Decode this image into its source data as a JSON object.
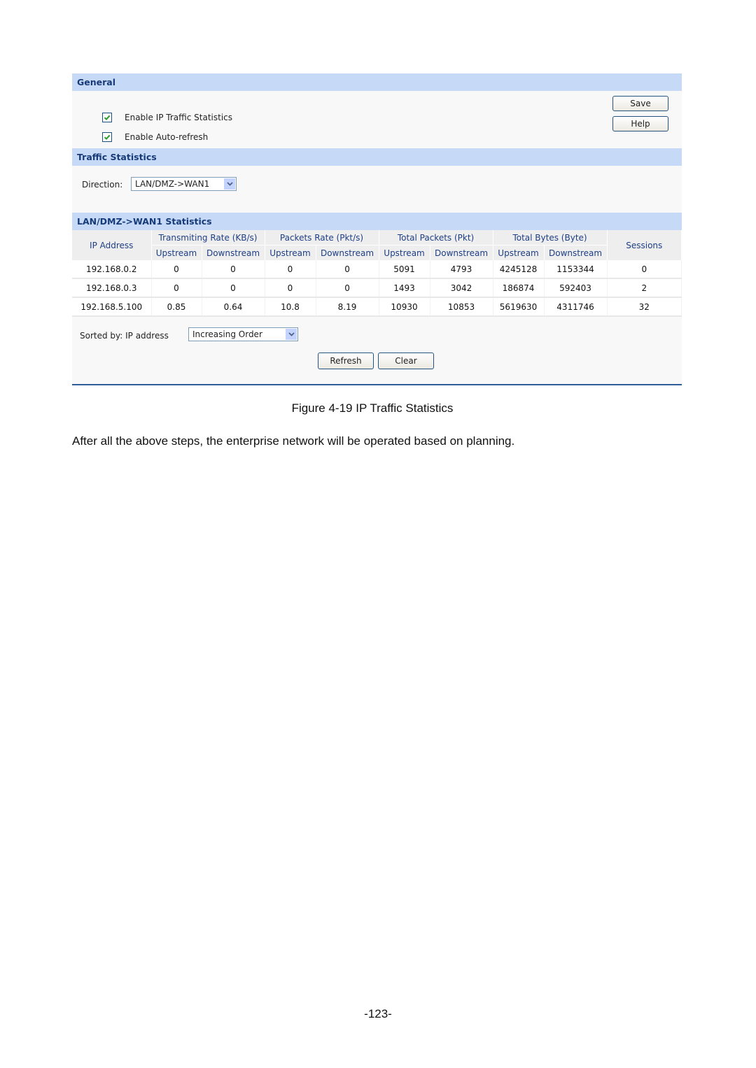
{
  "general": {
    "title": "General",
    "checkboxes": [
      {
        "label": "Enable IP Traffic Statistics",
        "checked": true
      },
      {
        "label": "Enable Auto-refresh",
        "checked": true
      }
    ],
    "save_label": "Save",
    "help_label": "Help"
  },
  "traffic": {
    "title": "Traffic Statistics",
    "direction_label": "Direction:",
    "direction_value": "LAN/DMZ->WAN1"
  },
  "stats": {
    "title": "LAN/DMZ->WAN1 Statistics",
    "headers": {
      "ip": "IP Address",
      "groups": [
        "Transmiting Rate (KB/s)",
        "Packets Rate (Pkt/s)",
        "Total Packets (Pkt)",
        "Total Bytes (Byte)"
      ],
      "upstream": "Upstream",
      "downstream": "Downstream",
      "sessions": "Sessions"
    },
    "rows": [
      [
        "192.168.0.2",
        "0",
        "0",
        "0",
        "0",
        "5091",
        "4793",
        "4245128",
        "1153344",
        "0"
      ],
      [
        "192.168.0.3",
        "0",
        "0",
        "0",
        "0",
        "1493",
        "3042",
        "186874",
        "592403",
        "2"
      ],
      [
        "192.168.5.100",
        "0.85",
        "0.64",
        "10.8",
        "8.19",
        "10930",
        "10853",
        "5619630",
        "4311746",
        "32"
      ]
    ],
    "sort_label": "Sorted by: IP address",
    "sort_value": "Increasing Order",
    "refresh_label": "Refresh",
    "clear_label": "Clear"
  },
  "document": {
    "caption": "Figure 4-19 IP Traffic Statistics",
    "paragraph": "After all the above steps, the enterprise network will be operated based on planning.",
    "page_number": "-123-"
  },
  "colors": {
    "section_header_bg": "#c6daf8",
    "section_header_text": "#173b78",
    "panel_bottom_rule": "#2d5d9a",
    "check_green": "#2a9d2a"
  }
}
